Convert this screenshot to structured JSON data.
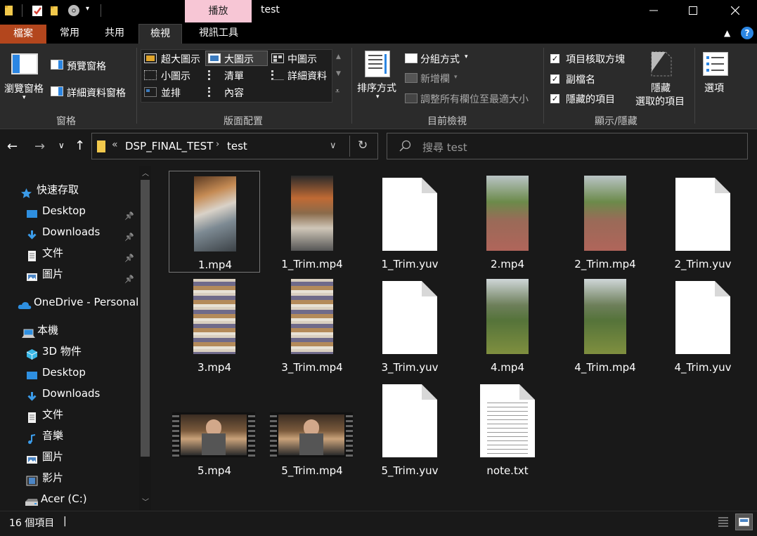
{
  "window": {
    "title": "test",
    "context_tab": "播放"
  },
  "ribbon_tabs": [
    "檔案",
    "常用",
    "共用",
    "檢視",
    "視訊工具"
  ],
  "ribbon": {
    "panes": {
      "label": "窗格",
      "nav_pane": "瀏覽窗格",
      "preview_pane": "預覽窗格",
      "details_pane": "詳細資料窗格"
    },
    "layout": {
      "label": "版面配置",
      "items": [
        "超大圖示",
        "大圖示",
        "中圖示",
        "小圖示",
        "清單",
        "詳細資料",
        "並排",
        "內容"
      ],
      "selected": "大圖示"
    },
    "current_view": {
      "label": "目前檢視",
      "sort": "排序方式",
      "group_by": "分組方式",
      "add_columns": "新增欄",
      "size_all_columns": "調整所有欄位至最適大小"
    },
    "show_hide": {
      "label": "顯示/隱藏",
      "item_checkboxes": "項目核取方塊",
      "file_extensions": "副檔名",
      "hidden_items": "隱藏的項目",
      "hide_selected_line1": "隱藏",
      "hide_selected_line2": "選取的項目"
    },
    "options": "選項"
  },
  "address": {
    "prefix": "«",
    "crumbs": [
      "DSP_FINAL_TEST",
      "test"
    ],
    "search_placeholder": "搜尋 test"
  },
  "sidebar": [
    {
      "label": "快速存取",
      "icon": "star-icon"
    },
    {
      "label": "Desktop",
      "icon": "desktop-icon",
      "pinned": true
    },
    {
      "label": "Downloads",
      "icon": "download-icon",
      "pinned": true
    },
    {
      "label": "文件",
      "icon": "document-icon",
      "pinned": true
    },
    {
      "label": "圖片",
      "icon": "pictures-icon",
      "pinned": true
    },
    {
      "label": "OneDrive - Personal",
      "icon": "cloud-icon"
    },
    {
      "label": "本機",
      "icon": "computer-icon"
    },
    {
      "label": "3D 物件",
      "icon": "cube-icon"
    },
    {
      "label": "Desktop",
      "icon": "desktop-icon"
    },
    {
      "label": "Downloads",
      "icon": "download-icon"
    },
    {
      "label": "文件",
      "icon": "document-icon"
    },
    {
      "label": "音樂",
      "icon": "music-icon"
    },
    {
      "label": "圖片",
      "icon": "pictures-icon"
    },
    {
      "label": "影片",
      "icon": "video-icon"
    },
    {
      "label": "Acer (C:)",
      "icon": "drive-icon"
    }
  ],
  "files": [
    {
      "name": "1.mp4",
      "kind": "video-mall",
      "selected": true
    },
    {
      "name": "1_Trim.mp4",
      "kind": "video-mall2"
    },
    {
      "name": "1_Trim.yuv",
      "kind": "blank"
    },
    {
      "name": "2.mp4",
      "kind": "video-path"
    },
    {
      "name": "2_Trim.mp4",
      "kind": "video-path"
    },
    {
      "name": "2_Trim.yuv",
      "kind": "blank"
    },
    {
      "name": "3.mp4",
      "kind": "video-books"
    },
    {
      "name": "3_Trim.mp4",
      "kind": "video-books"
    },
    {
      "name": "3_Trim.yuv",
      "kind": "blank"
    },
    {
      "name": "4.mp4",
      "kind": "video-grass"
    },
    {
      "name": "4_Trim.mp4",
      "kind": "video-grass"
    },
    {
      "name": "4_Trim.yuv",
      "kind": "blank"
    },
    {
      "name": "5.mp4",
      "kind": "video-wide"
    },
    {
      "name": "5_Trim.mp4",
      "kind": "video-wide"
    },
    {
      "name": "5_Trim.yuv",
      "kind": "blank"
    },
    {
      "name": "note.txt",
      "kind": "text"
    }
  ],
  "status": {
    "count": "16 個項目"
  }
}
